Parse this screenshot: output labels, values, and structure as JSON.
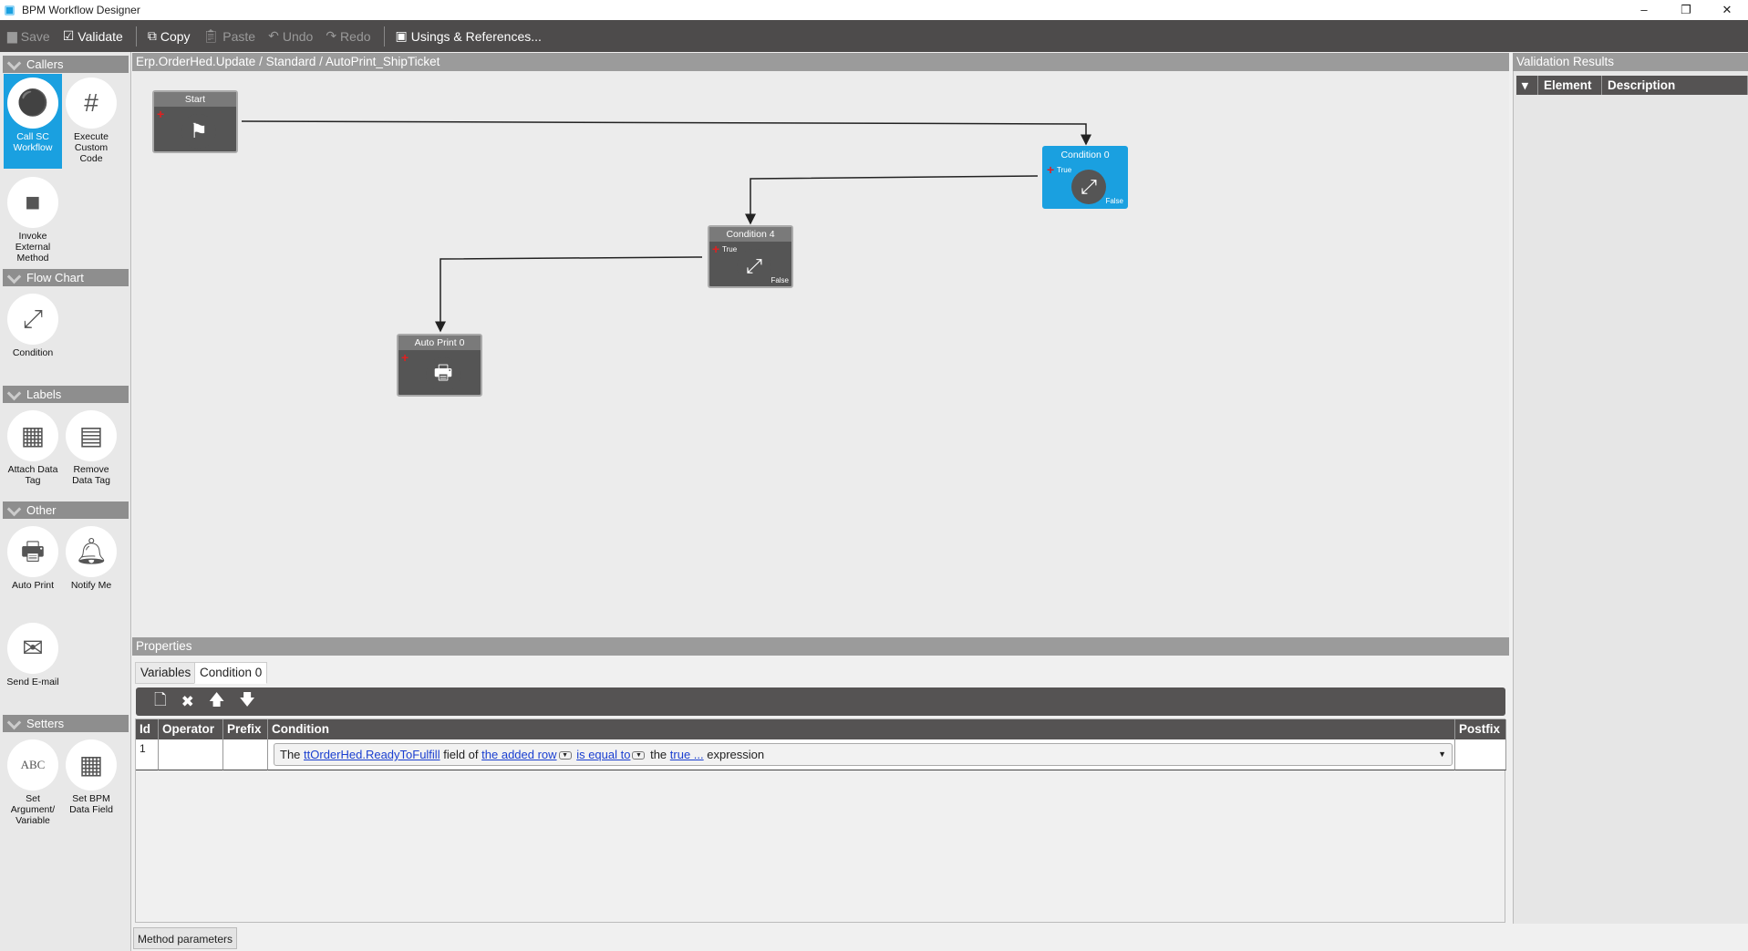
{
  "window": {
    "title": "BPM Workflow Designer",
    "minimize": "–",
    "restore": "❐",
    "close": "✕"
  },
  "toolbar": {
    "save": "Save",
    "validate": "Validate",
    "copy": "Copy",
    "paste": "Paste",
    "undo": "Undo",
    "redo": "Redo",
    "usings": "Usings & References..."
  },
  "sidebar": {
    "sections": [
      {
        "title": "Callers",
        "items": [
          "Call SC Workflow",
          "Execute Custom Code",
          "Invoke External Method"
        ]
      },
      {
        "title": "Flow Chart",
        "items": [
          "Condition"
        ]
      },
      {
        "title": "Labels",
        "items": [
          "Attach Data Tag",
          "Remove Data Tag"
        ]
      },
      {
        "title": "Other",
        "items": [
          "Auto Print",
          "Notify Me",
          "Send E-mail"
        ]
      },
      {
        "title": "Setters",
        "items": [
          "Set Argument/ Variable",
          "Set BPM Data Field"
        ]
      }
    ],
    "selected": "Call SC Workflow"
  },
  "breadcrumb": "Erp.OrderHed.Update / Standard / AutoPrint_ShipTicket",
  "canvas": {
    "nodes": [
      {
        "title": "Start",
        "icon": "flag-icon"
      },
      {
        "title": "Condition 0",
        "icon": "condition-icon",
        "true": "True",
        "false": "False",
        "selected": true
      },
      {
        "title": "Condition 4",
        "icon": "condition-icon",
        "true": "True",
        "false": "False"
      },
      {
        "title": "Auto Print 0",
        "icon": "printer-icon"
      }
    ]
  },
  "properties": {
    "title": "Properties",
    "tabs": [
      "Variables",
      "Condition 0"
    ],
    "active_tab": "Condition 0",
    "columns": [
      "Id",
      "Operator",
      "Prefix",
      "Condition",
      "Postfix"
    ],
    "rows": [
      {
        "id": "1",
        "operator": "",
        "prefix": "",
        "condition": {
          "p1": "The",
          "field": "ttOrderHed.ReadyToFulfill",
          "p2": "field of",
          "row": "the added row",
          "op": "is equal to",
          "p3": "the",
          "value": "true ...",
          "p4": "expression"
        },
        "postfix": ""
      }
    ],
    "bottom_tab": "Method parameters"
  },
  "validation": {
    "title": "Validation Results",
    "columns": [
      "Element",
      "Description"
    ]
  },
  "colors": {
    "accent": "#1aa0e0",
    "toolbar": "#4d4b4b"
  }
}
